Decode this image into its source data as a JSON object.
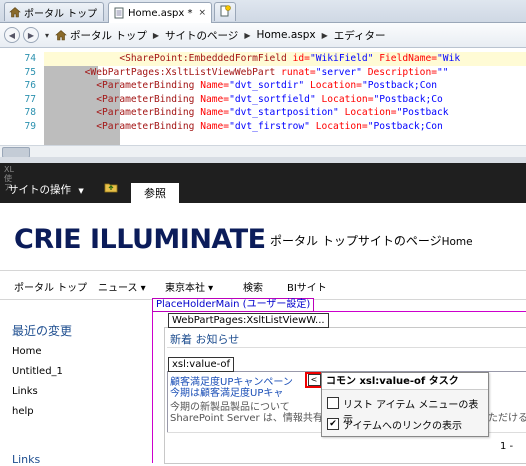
{
  "tabs": [
    {
      "label": "ポータル トップ",
      "active": false
    },
    {
      "label": "Home.aspx *",
      "active": true,
      "close": "×"
    }
  ],
  "breadcrumb": {
    "items": [
      "ポータル トップ",
      "サイトのページ",
      "Home.aspx",
      "エディター"
    ]
  },
  "code": {
    "lines": [
      {
        "num": "74",
        "indent": "            ",
        "tag": "<SharePoint:EmbeddedFormField",
        "a1": " id=",
        "v1": "\"WikiField\"",
        "a2": " FieldName=",
        "v2": "\"Wik"
      },
      {
        "num": "75",
        "indent": "      ",
        "tag": "<WebPartPages:XsltListViewWebPart",
        "a1": " runat=",
        "v1": "\"server\"",
        "a2": " Description=",
        "v2": "\"\""
      },
      {
        "num": "76",
        "indent": "        ",
        "tag": "<ParameterBinding",
        "a1": " Name=",
        "v1": "\"dvt_sortdir\"",
        "a2": " Location=",
        "v2": "\"Postback;Con"
      },
      {
        "num": "77",
        "indent": "        ",
        "tag": "<ParameterBinding",
        "a1": " Name=",
        "v1": "\"dvt_sortfield\"",
        "a2": " Location=",
        "v2": "\"Postback;Co"
      },
      {
        "num": "78",
        "indent": "        ",
        "tag": "<ParameterBinding",
        "a1": " Name=",
        "v1": "\"dvt_startposition\"",
        "a2": " Location=",
        "v2": "\"Postback"
      },
      {
        "num": "79",
        "indent": "        ",
        "tag": "<ParameterBinding",
        "a1": " Name=",
        "v1": "\"dvt_firstrow\"",
        "a2": " Location=",
        "v2": "\"Postback;Con"
      }
    ]
  },
  "ribbon": {
    "side_text": "XL\n使\nア",
    "site_actions": "サイトの操作",
    "browse_tab": "参照"
  },
  "header": {
    "logo": "CRIE ILLUMINATE",
    "site_title": "ポータル トップサイトのページ",
    "site_title_suffix": "Home"
  },
  "topnav": {
    "items": [
      "ポータル トップ",
      "ニュース ▾",
      "東京本社 ▾",
      "検索",
      "BIサイト"
    ]
  },
  "leftnav": {
    "title": "最近の変更",
    "items": [
      "Home",
      "Untitled_1",
      "Links",
      "help"
    ],
    "section": "Links"
  },
  "content": {
    "placeholder_label": "PlaceHolderMain (ユーザー設定)",
    "webpart_label": "WebPartPages:XsltListViewW...",
    "webpart_title": "新着 お知らせ",
    "xsl_label": "xsl:value-of",
    "item1": "顧客満足度UPキャンペーン",
    "item2": "今期は顧客満足度UPキャ",
    "gray1": "今期の新製品製品について",
    "gray2": "SharePoint Server は、情報共有",
    "gray_right": "ただける事",
    "pager": "1 -"
  },
  "smart_panel": {
    "header": "コモン xsl:value-of タスク",
    "options": [
      {
        "label": "リスト アイテム メニューの表示",
        "checked": false
      },
      {
        "label": "アイテムへのリンクの表示",
        "checked": true
      }
    ],
    "check_mark": "✔",
    "button_glyph": "<"
  }
}
